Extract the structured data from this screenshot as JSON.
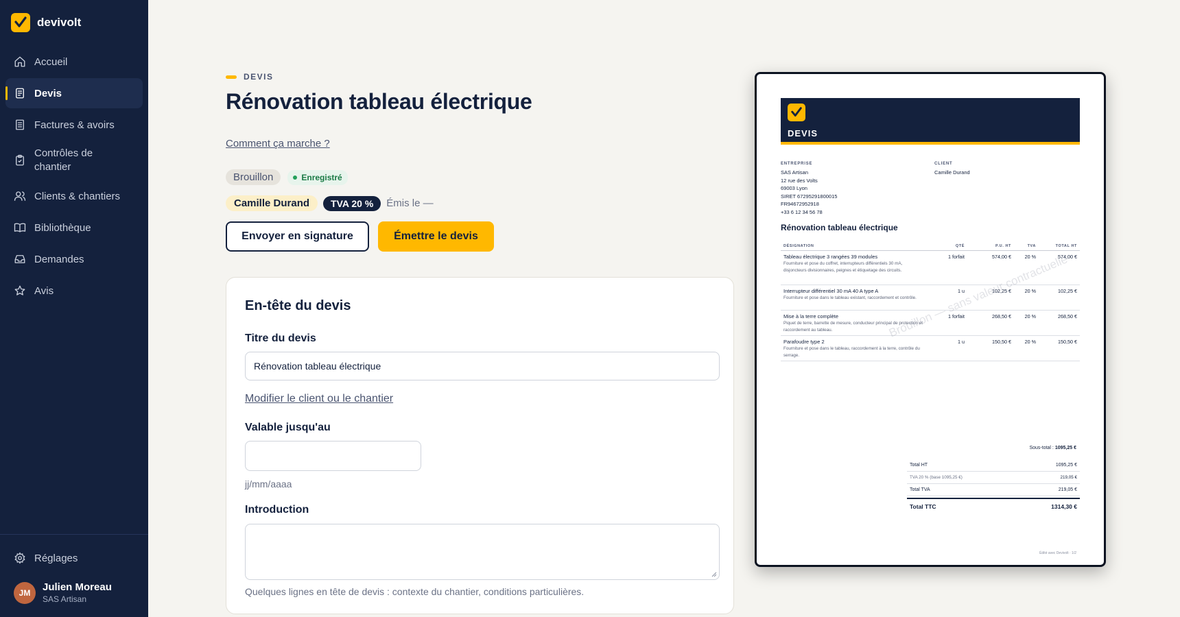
{
  "brand": {
    "name": "devivolt"
  },
  "nav": {
    "items": [
      {
        "label": "Accueil",
        "icon": "home-icon"
      },
      {
        "label": "Devis",
        "icon": "document-icon",
        "active": true
      },
      {
        "label": "Factures & avoirs",
        "icon": "invoice-icon"
      },
      {
        "label": "Contrôles de chantier",
        "icon": "clipboard-check-icon"
      },
      {
        "label": "Clients & chantiers",
        "icon": "users-icon"
      },
      {
        "label": "Bibliothèque",
        "icon": "book-icon"
      },
      {
        "label": "Demandes",
        "icon": "inbox-icon"
      },
      {
        "label": "Avis",
        "icon": "star-icon"
      }
    ],
    "settings": "Réglages"
  },
  "user": {
    "initials": "JM",
    "name": "Julien Moreau",
    "company": "SAS Artisan"
  },
  "header": {
    "eyebrow": "DEVIS",
    "title": "Rénovation tableau électrique",
    "how_link": "Comment ça marche ?",
    "status_badge": "Brouillon",
    "saved_badge": "Enregistré",
    "client_chip": "Camille Durand",
    "tva_chip": "TVA 20 %",
    "emis": "Émis le —",
    "send_button": "Envoyer en signature",
    "emit_button": "Émettre le devis"
  },
  "form": {
    "section_title": "En-tête du devis",
    "title_label": "Titre du devis",
    "title_value": "Rénovation tableau électrique",
    "client_link": "Modifier le client ou le chantier",
    "valid_label": "Valable jusqu'au",
    "valid_value": "",
    "valid_hint": "jj/mm/aaaa",
    "intro_label": "Introduction",
    "intro_value": "",
    "intro_hint": "Quelques lignes en tête de devis : contexte du chantier, conditions particulières."
  },
  "doc": {
    "header_title": "DEVIS",
    "company_label": "ENTREPRISE",
    "company_lines": [
      "SAS Artisan",
      "12 rue des Volts",
      "69003 Lyon",
      "SIRET 67295291800015",
      "FR94672952918",
      "+33 6 12 34 56 78"
    ],
    "client_label": "CLIENT",
    "client_name": "Camille Durand",
    "title": "Rénovation tableau électrique",
    "columns": {
      "designation": "DÉSIGNATION",
      "qty": "QTÉ",
      "unit_price": "P.U. HT",
      "tva": "TVA",
      "total": "TOTAL HT"
    },
    "lines": [
      {
        "title": "Tableau électrique 3 rangées 39 modules",
        "desc": "Fourniture et pose du coffret, interrupteurs différentiels 30 mA, disjoncteurs divisionnaires, peignes et étiquetage des circuits.",
        "qty": "1 forfait",
        "unit": "574,00 €",
        "tva": "20 %",
        "total": "574,00 €"
      },
      {
        "title": "Interrupteur différentiel 30 mA 40 A type A",
        "desc": "Fourniture et pose dans le tableau existant, raccordement et contrôle.",
        "qty": "1 u",
        "unit": "102,25 €",
        "tva": "20 %",
        "total": "102,25 €"
      },
      {
        "title": "Mise à la terre complète",
        "desc": "Piquet de terre, barrette de mesure, conducteur principal de protection et raccordement au tableau.",
        "qty": "1 forfait",
        "unit": "268,50 €",
        "tva": "20 %",
        "total": "268,50 €"
      },
      {
        "title": "Parafoudre type 2",
        "desc": "Fourniture et pose dans le tableau, raccordement à la terre, contrôle du serrage.",
        "qty": "1 u",
        "unit": "150,50 €",
        "tva": "20 %",
        "total": "150,50 €"
      }
    ],
    "subtotal_label": "Sous-total :",
    "subtotal_value": "1095,25 €",
    "totals": {
      "ht_label": "Total HT",
      "ht_value": "1095,25 €",
      "tva_base_label": "TVA 20 % (base 1095,25 €)",
      "tva_base_value": "219,05 €",
      "tva_label": "Total TVA",
      "tva_value": "219,05 €",
      "ttc_label": "Total TTC",
      "ttc_value": "1314,30 €"
    },
    "watermark": "Brouillon — sans valeur contractuelle",
    "footer": "Édité avec Devivolt · 1/2"
  },
  "colors": {
    "sidebar": "#14213d",
    "accent": "#ffb800",
    "background": "#f5f4f0",
    "success": "#1a7a45"
  }
}
